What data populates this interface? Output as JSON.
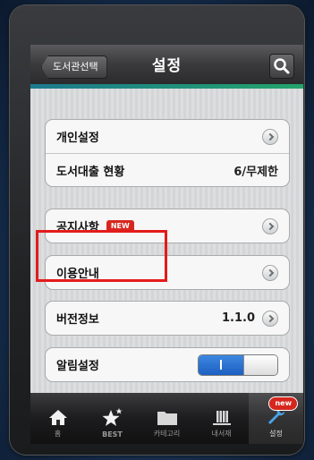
{
  "navbar": {
    "back_label": "도서관선택",
    "title": "설정",
    "search_icon": "search-icon"
  },
  "settings": {
    "group1": [
      {
        "label": "개인설정",
        "type": "link"
      },
      {
        "label": "도서대출 현황",
        "value": "6/무제한",
        "type": "value"
      }
    ],
    "group2": [
      {
        "label": "공지사항",
        "badge": "NEW",
        "type": "link"
      }
    ],
    "group3": [
      {
        "label": "이용안내",
        "type": "link"
      }
    ],
    "group4": [
      {
        "label": "버전정보",
        "value": "1.1.0",
        "type": "link"
      }
    ],
    "group5": [
      {
        "label": "알림설정",
        "toggle_state": "on",
        "toggle_on_text": "I"
      }
    ]
  },
  "footnote": "",
  "tabbar": {
    "tabs": [
      {
        "label": "홈",
        "icon": "home-icon"
      },
      {
        "label": "BEST",
        "icon": "star-icon"
      },
      {
        "label": "카테고리",
        "icon": "folder-icon"
      },
      {
        "label": "내서재",
        "icon": "bookshelf-icon"
      },
      {
        "label": "설정",
        "icon": "wrench-icon",
        "badge": "new",
        "active": true
      }
    ]
  },
  "colors": {
    "accent_start": "#1c7a8e",
    "accent_end": "#23a36a",
    "badge_red": "#d6271f",
    "toggle_blue": "#1c5fc2",
    "highlight_red": "#e31b1b"
  }
}
